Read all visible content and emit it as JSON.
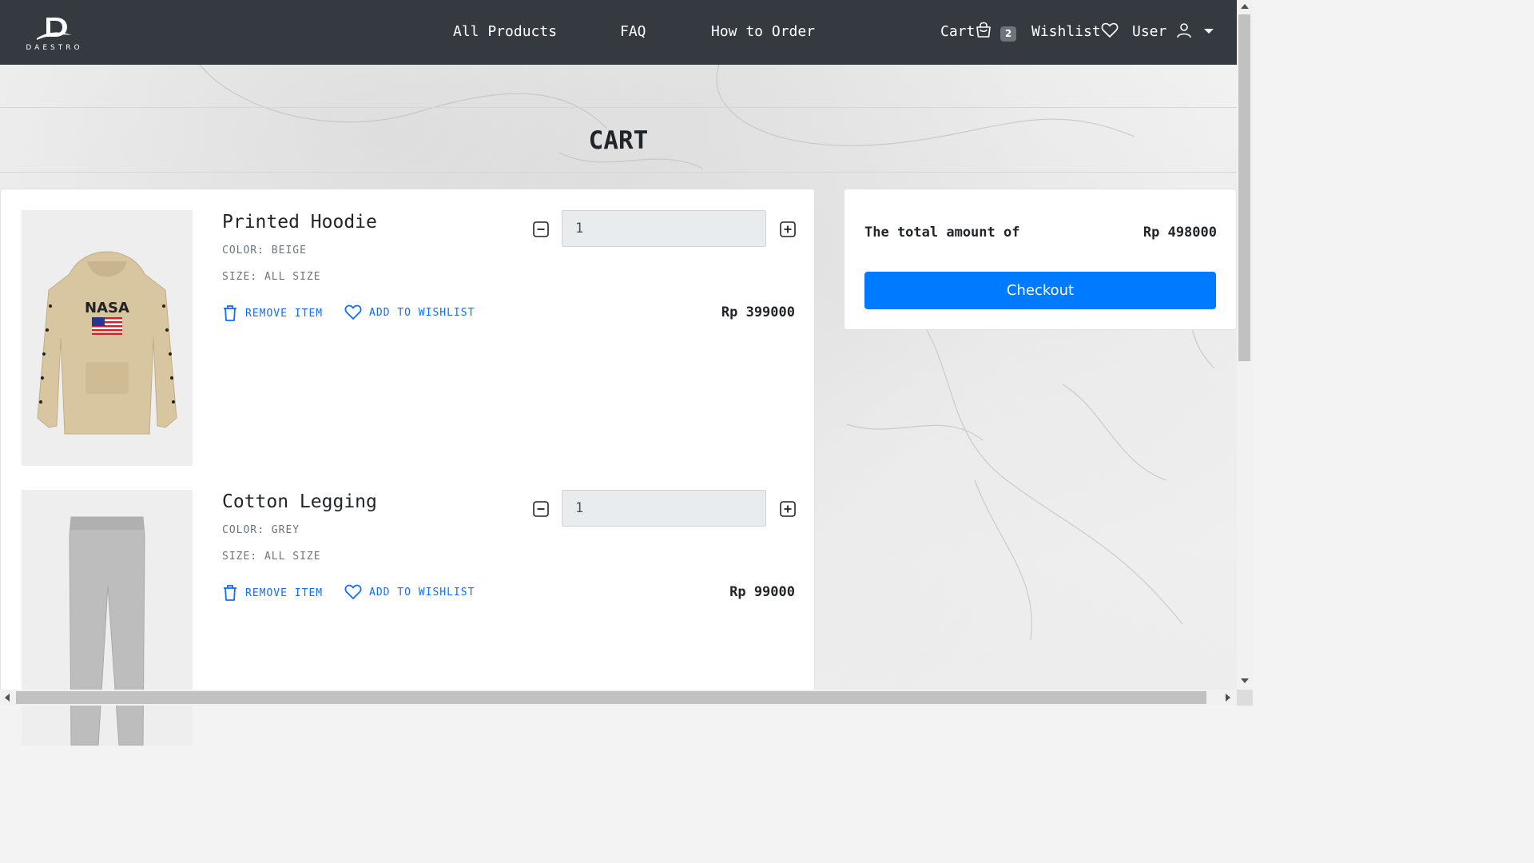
{
  "header": {
    "logo_text": "DAESTRO",
    "nav": {
      "all_products": "All Products",
      "faq": "FAQ",
      "how_to_order": "How to Order"
    },
    "cart_label": "Cart",
    "cart_count": "2",
    "wishlist_label": "Wishlist",
    "user_label": "User"
  },
  "page_title": "CART",
  "items": [
    {
      "name": "Printed Hoodie",
      "color": "COLOR: BEIGE",
      "size": "SIZE: ALL SIZE",
      "remove_label": "REMOVE ITEM",
      "wishlist_label": "ADD TO WISHLIST",
      "quantity": "1",
      "price": "Rp 399000"
    },
    {
      "name": "Cotton Legging",
      "color": "COLOR: GREY",
      "size": "SIZE: ALL SIZE",
      "remove_label": "REMOVE ITEM",
      "wishlist_label": "ADD TO WISHLIST",
      "quantity": "1",
      "price": "Rp 99000"
    }
  ],
  "summary": {
    "label": "The total amount of",
    "total": "Rp 498000",
    "checkout_label": "Checkout"
  },
  "colors": {
    "navbar": "#343a40",
    "primary": "#007bff",
    "link": "#0d6efd"
  }
}
